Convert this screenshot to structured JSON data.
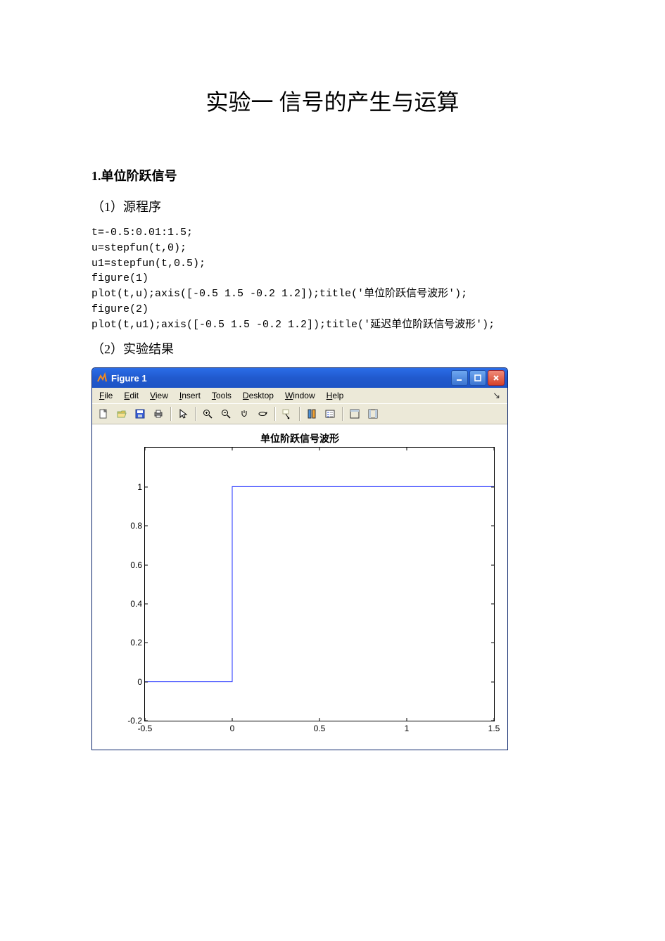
{
  "title": "实验一 信号的产生与运算",
  "section1": "1.单位阶跃信号",
  "sub1": "（1）源程序",
  "code": "t=-0.5:0.01:1.5;\nu=stepfun(t,0);\nu1=stepfun(t,0.5);\nfigure(1)\nplot(t,u);axis([-0.5 1.5 -0.2 1.2]);title('单位阶跃信号波形');\nfigure(2)\nplot(t,u1);axis([-0.5 1.5 -0.2 1.2]);title('延迟单位阶跃信号波形');",
  "sub2": "（2）实验结果",
  "figure": {
    "window_title": "Figure 1",
    "menus": {
      "file": "File",
      "edit": "Edit",
      "view": "View",
      "insert": "Insert",
      "tools": "Tools",
      "desktop": "Desktop",
      "window": "Window",
      "help": "Help"
    },
    "plot": {
      "title": "单位阶跃信号波形",
      "x_ticks": [
        "-0.5",
        "0",
        "0.5",
        "1",
        "1.5"
      ],
      "y_ticks": [
        "-0.2",
        "0",
        "0.2",
        "0.4",
        "0.6",
        "0.8",
        "1"
      ]
    }
  },
  "chart_data": {
    "type": "line",
    "title": "单位阶跃信号波形",
    "xlabel": "",
    "ylabel": "",
    "xlim": [
      -0.5,
      1.5
    ],
    "ylim": [
      -0.2,
      1.2
    ],
    "x": [
      -0.5,
      0,
      0,
      1.5
    ],
    "values": [
      0,
      0,
      1,
      1
    ]
  }
}
